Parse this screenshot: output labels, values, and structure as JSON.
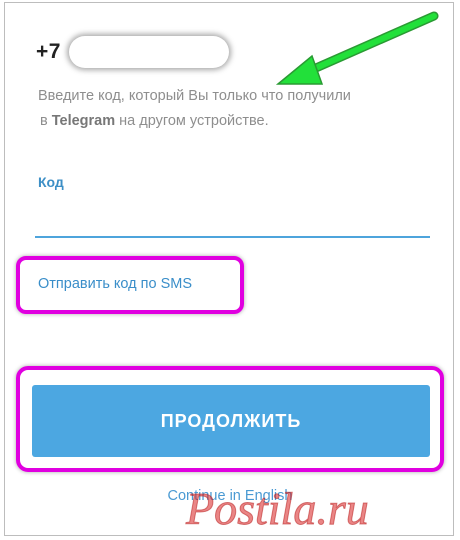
{
  "phone": {
    "prefix": "+7"
  },
  "description": {
    "line1": "Введите код, который Вы только что получили",
    "line2_prefix": "в ",
    "line2_app": "Telegram",
    "line2_suffix": " на другом устройстве."
  },
  "code_field": {
    "label": "Код",
    "value": ""
  },
  "sms_link": {
    "label": "Отправить код по SMS"
  },
  "continue_button": {
    "label": "ПРОДОЛЖИТЬ"
  },
  "language_link": {
    "label": "Continue in English"
  },
  "watermark": {
    "text": "Postila.ru"
  },
  "colors": {
    "accent": "#4ca7e1",
    "link": "#3a8ec9",
    "highlight": "#e000e0",
    "arrow": "#22e03a"
  },
  "icons": {
    "annotation_arrow": "green-arrow-icon"
  }
}
